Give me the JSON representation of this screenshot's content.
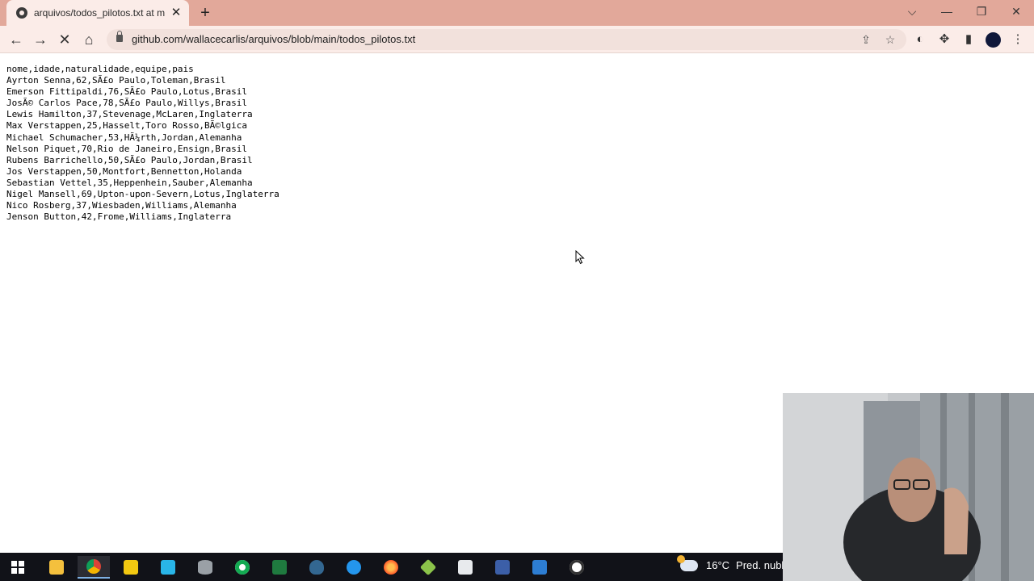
{
  "browser": {
    "tab_title": "arquivos/todos_pilotos.txt at main",
    "new_tab": "+",
    "close_tab": "✕",
    "url": "github.com/wallacecarlis/arquivos/blob/main/todos_pilotos.txt"
  },
  "file_lines": [
    "nome,idade,naturalidade,equipe,pais",
    "Ayrton Senna,62,SÃ£o Paulo,Toleman,Brasil",
    "Emerson Fittipaldi,76,SÃ£o Paulo,Lotus,Brasil",
    "JosÃ© Carlos Pace,78,SÃ£o Paulo,Willys,Brasil",
    "Lewis Hamilton,37,Stevenage,McLaren,Inglaterra",
    "Max Verstappen,25,Hasselt,Toro Rosso,BÃ©lgica",
    "Michael Schumacher,53,HÃ¼rth,Jordan,Alemanha",
    "Nelson Piquet,70,Rio de Janeiro,Ensign,Brasil",
    "Rubens Barrichello,50,SÃ£o Paulo,Jordan,Brasil",
    "Jos Verstappen,50,Montfort,Bennetton,Holanda",
    "Sebastian Vettel,35,Heppenhein,Sauber,Alemanha",
    "Nigel Mansell,69,Upton-upon-Severn,Lotus,Inglaterra",
    "Nico Rosberg,37,Wiesbaden,Williams,Alemanha",
    "Jenson Button,42,Frome,Williams,Inglaterra"
  ],
  "taskbar": {
    "apps": [
      "windows-start",
      "file-explorer",
      "chrome",
      "power-bi",
      "snowflake",
      "database",
      "mongodb",
      "excel",
      "postgresql",
      "docker",
      "firefox",
      "virtual-box",
      "media-player",
      "vs-code",
      "photos",
      "clock"
    ],
    "weather_temp": "16°C",
    "weather_desc": "Pred. nubl."
  },
  "colors": {
    "tabbar": "#e2a89a",
    "toolbar": "#fbece8",
    "taskbar": "#111218"
  }
}
